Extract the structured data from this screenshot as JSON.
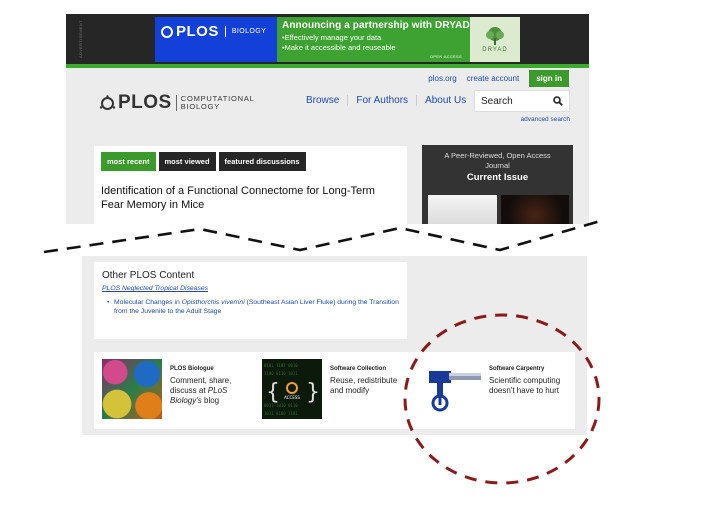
{
  "banner": {
    "side_text": "ADVERTISEMENT",
    "plos_word": "PLOS",
    "journal": "BIOLOGY",
    "headline": "Announcing a partnership with DRYAD",
    "bullets": [
      "Effectively manage your data",
      "Make it accessible and reuseable"
    ],
    "open_access": "OPEN ACCESS",
    "dryad_word": "DRYAD"
  },
  "utility_nav": {
    "plos_org": "plos.org",
    "create_account": "create account",
    "sign_in": "sign in"
  },
  "logo": {
    "plos_word": "PLOS",
    "journal_line1": "COMPUTATIONAL",
    "journal_line2": "BIOLOGY"
  },
  "main_nav": [
    "Browse",
    "For Authors",
    "About Us"
  ],
  "search": {
    "placeholder": "Search",
    "advanced": "advanced search"
  },
  "tabs": [
    "most recent",
    "most viewed",
    "featured discussions"
  ],
  "article_title": "Identification of a Functional Connectome for Long-Term Fear Memory in Mice",
  "current_issue": {
    "subtitle": "A Peer-Reviewed, Open Access Journal",
    "title": "Current Issue"
  },
  "other_content": {
    "heading": "Other PLOS Content",
    "ntd_link": "PLOS Neglected Tropical Diseases",
    "item_prefix": "Molecular Changes in ",
    "item_italic": "Opisthorchis viverrini",
    "item_suffix": " (Southeast Asian Liver Fluke) during the Transition from the Juvenile to the Adult Stage"
  },
  "promos": {
    "biologue": {
      "title": "PLOS Biologue",
      "desc_prefix": "Comment, share, discuss at ",
      "desc_italic": "PLoS Biology's",
      "desc_suffix": " blog"
    },
    "collection": {
      "title": "Software Collection",
      "desc": "Reuse, redistribute and modify",
      "thumb_text": "ACCESS"
    },
    "carpentry": {
      "title": "Software Carpentry",
      "desc": "Scientific computing doesn't have to hurt"
    }
  },
  "colors": {
    "plos_green": "#3b9a2b",
    "plos_blue": "#1340d8",
    "link_blue": "#1f4aa8",
    "dark": "#262626",
    "circle_red": "#8b1a1a"
  }
}
